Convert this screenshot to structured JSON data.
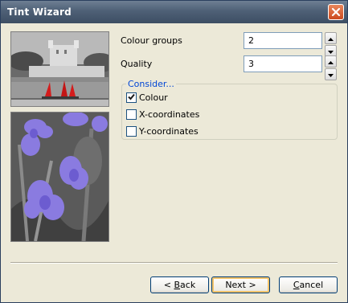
{
  "window": {
    "title": "Tint Wizard"
  },
  "fields": [
    {
      "label": "Colour groups",
      "value": "2"
    },
    {
      "label": "Quality",
      "value": "3"
    }
  ],
  "consider": {
    "title": "Consider...",
    "options": [
      {
        "label": "Colour",
        "checked": true
      },
      {
        "label": "X-coordinates",
        "checked": false
      },
      {
        "label": "Y-coordinates",
        "checked": false
      }
    ]
  },
  "buttons": {
    "back": {
      "mnemonic": "B",
      "rest": "ack",
      "prefix": "< "
    },
    "next": {
      "label": "Next >"
    },
    "cancel": {
      "mnemonic": "C",
      "rest": "ancel"
    }
  },
  "images": {
    "top": "tower-of-london-photo-red-sails",
    "bottom": "purple-crocus-flowers-photo"
  },
  "colors": {
    "titlebar": "#4e6076",
    "close": "#d75a2c",
    "groupTitle": "#0046d5",
    "face": "#ece9d8"
  }
}
